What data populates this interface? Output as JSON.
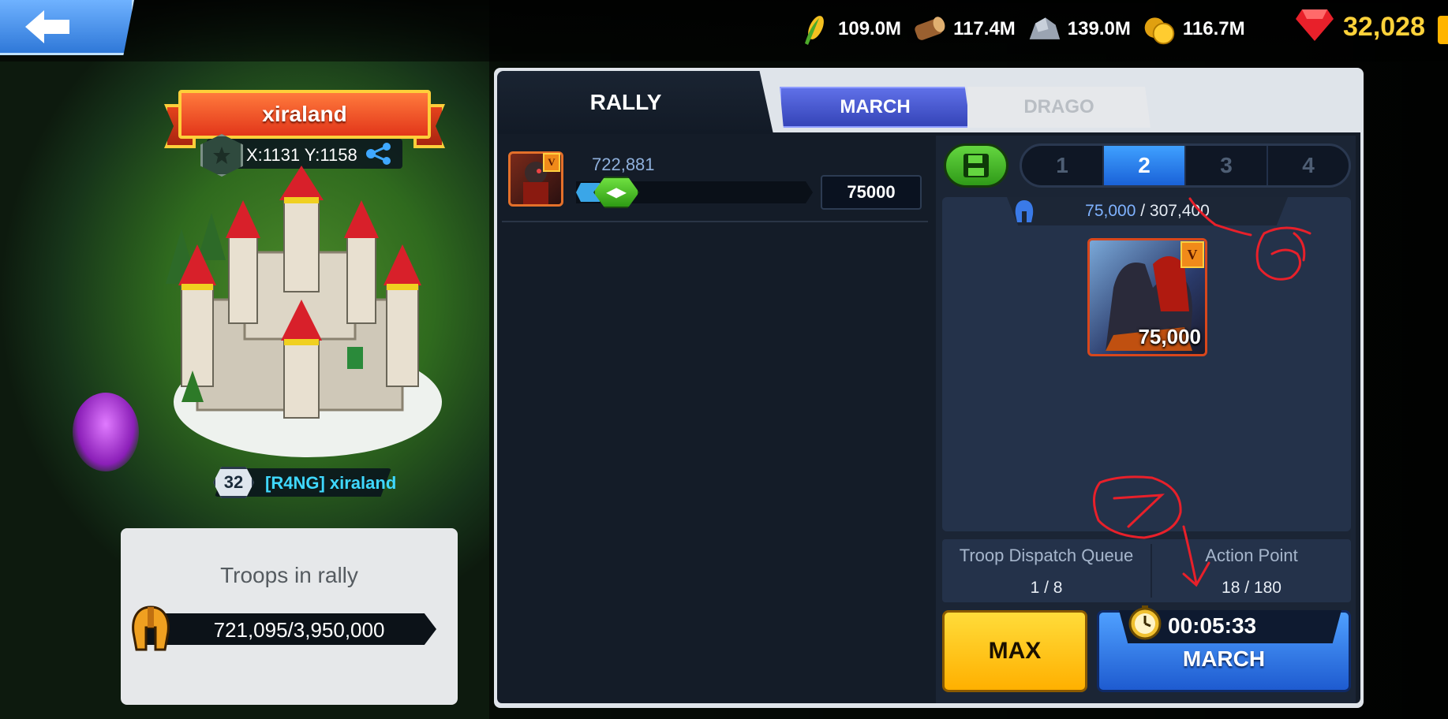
{
  "resources": [
    {
      "icon": "corn-icon",
      "value": "109.0M"
    },
    {
      "icon": "wood-log-icon",
      "value": "117.4M"
    },
    {
      "icon": "stone-icon",
      "value": "139.0M"
    },
    {
      "icon": "gold-coins-icon",
      "value": "116.7M"
    }
  ],
  "gems": {
    "icon": "ruby-gem-icon",
    "value": "32,028"
  },
  "castle": {
    "name": "xiraland",
    "coords": "X:1131 Y:1158",
    "level": "32",
    "owner": "[R4NG] xiraland"
  },
  "rally_card": {
    "title": "Troops in rally",
    "troops": "721,095/3,950,000"
  },
  "tabs": {
    "rally": "RALLY",
    "march": "MARCH",
    "drago": "DRAGO"
  },
  "hero_row": {
    "power": "722,881",
    "quantity": "75000",
    "tier": "V"
  },
  "slots": [
    "1",
    "2",
    "3",
    "4"
  ],
  "active_slot": "2",
  "capacity": {
    "current": "75,000",
    "separator": " / ",
    "max": "307,400"
  },
  "troop_tile": {
    "count": "75,000",
    "tier": "V"
  },
  "info": {
    "queue_label": "Troop Dispatch Queue",
    "queue_value": "1 / 8",
    "ap_label": "Action Point",
    "ap_value": "18 / 180"
  },
  "buttons": {
    "max": "MAX",
    "march_timer": "00:05:33",
    "march": "MARCH"
  },
  "colors": {
    "accent_blue": "#1a62d8",
    "gold": "#ffd23a",
    "annotation_red": "#e8202a"
  }
}
